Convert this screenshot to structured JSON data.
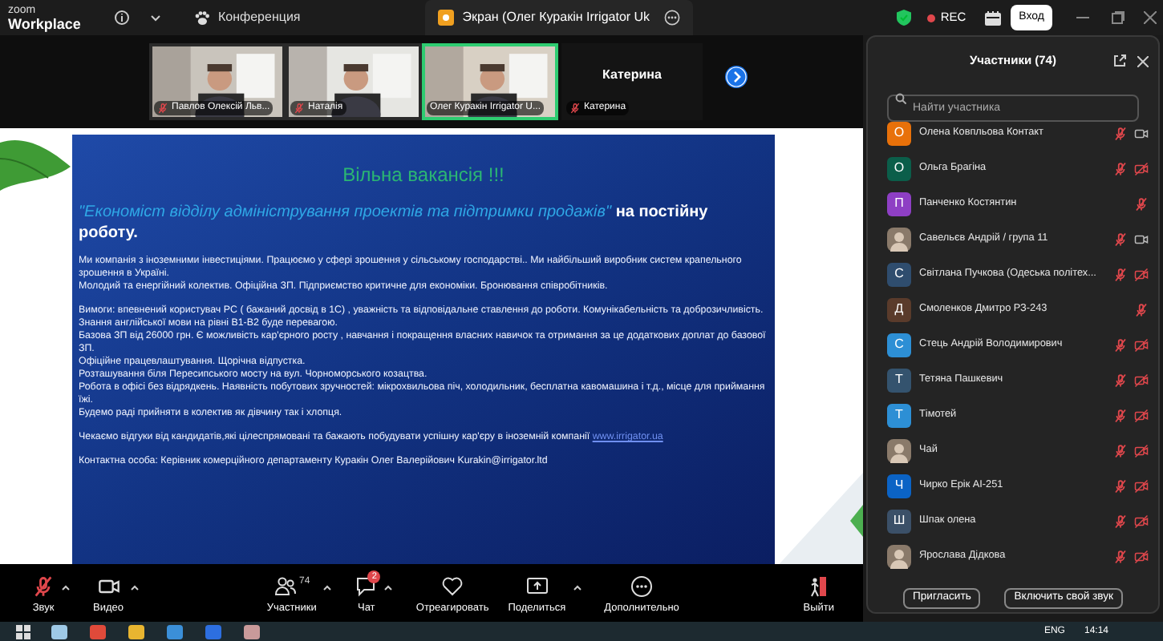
{
  "top_bar": {
    "logo_top": "zoom",
    "logo_bottom": "Workplace",
    "tabs": [
      {
        "label": "Конференция",
        "selected": false
      },
      {
        "label": "Экран (Олег Куракін Irrigator Uk",
        "selected": true
      }
    ],
    "recording": "REC",
    "signin": "Вход"
  },
  "gallery": {
    "tiles": [
      {
        "kind": "video",
        "name": "Павлов Олексій Льв...",
        "muted": true,
        "speaking": false
      },
      {
        "kind": "video",
        "name": "Наталія",
        "muted": true,
        "speaking": false
      },
      {
        "kind": "video",
        "name": "Олег Куракін Irrigator U...",
        "muted": false,
        "speaking": true
      },
      {
        "kind": "name_only",
        "name": "Катерина",
        "label": "Катерина",
        "muted": true,
        "speaking": false
      }
    ]
  },
  "slide": {
    "title": "Вільна вакансія !!!",
    "position": "\"Економіст відділу адміністрування проектів та підтримки продажів\"",
    "position_suffix": "на постійну роботу.",
    "groups": [
      [
        {
          "text": "Ми компанія з іноземними інвестиціями. Працюємо у сфері зрошення у сільському господарстві.. Ми найбільший виробник систем крапельного зрошення в Україні."
        },
        {
          "text": "Молодий та енергійний колектив. Офіційна ЗП. Підприємство критичне для економіки. Бронювання співробітників."
        }
      ],
      [
        {
          "text": "Вимоги: впевнений користувач PC ( бажаний досвід в 1С) , уважність та відповідальне ставлення до роботи. Комунікабельність та доброзичливість.  Знання англійської мови на рівні B1-B2 буде перевагою."
        },
        {
          "text": "Базова ЗП від 26000 грн. Є можливість кар'єрного росту , навчання і  покращення власних навичок та отримання за це додаткових доплат до базової ЗП."
        },
        {
          "text": "Офіційне працевлаштування. Щорічна відпустка."
        },
        {
          "text": "Розташування біля Пересипського мосту на вул. Чорноморського козацтва."
        },
        {
          "text": "Робота в офісі без відрядкень. Наявність побутових зручностей: мікрохвильова піч, холодильник, бесплатна кавомашина і т.д., місце для приймання їжі."
        },
        {
          "text": "Будемо раді прийняти в колектив як дівчину так і хлопця."
        }
      ],
      [
        {
          "text": "Чекаємо відгуки від кандидатів,які цілеспрямовані та бажають побудувати успішну кар'єру в іноземній компанії",
          "link": "www.irrigator.ua"
        }
      ],
      [
        {
          "text": "Контактна особа: Керівник комерційного департаменту Куракін Олег Валерійович  Kurakin@irrigator.ltd"
        }
      ]
    ]
  },
  "participants": {
    "title": "Участники (74)",
    "search": {
      "placeholder": "Найти участника"
    },
    "items": [
      {
        "name": "Олена Ковпльова Контакт",
        "avatar": {
          "kind": "letter",
          "letter": "О",
          "color": "#e8710a"
        },
        "muted": true,
        "video": true
      },
      {
        "name": "Ольга Брагіна",
        "avatar": {
          "kind": "letter",
          "letter": "О",
          "color": "#0b5e4a"
        },
        "muted": true,
        "video": false
      },
      {
        "name": "Панченко Костянтин",
        "avatar": {
          "kind": "letter",
          "letter": "П",
          "color": "#8e3fc4"
        },
        "muted": true
      },
      {
        "name": "Савельєв Андрій / група 11",
        "muted": true,
        "video": true
      },
      {
        "name": "Світлана Пучкова (Одеська політех...",
        "avatar": {
          "kind": "letter",
          "letter": "С",
          "color": "#2f4d6e"
        },
        "muted": true,
        "video": false
      },
      {
        "name": "Смоленков Дмитро РЗ-243",
        "avatar": {
          "kind": "letter",
          "letter": "Д",
          "color": "#5a3b2b"
        },
        "muted": true
      },
      {
        "name": "Стець Андрій Володимирович",
        "avatar": {
          "kind": "letter",
          "letter": "С",
          "color": "#2d8fd5"
        },
        "muted": true,
        "video": false
      },
      {
        "name": "Тетяна Пашкевич",
        "avatar": {
          "kind": "letter",
          "letter": "Т",
          "color": "#34536e"
        },
        "muted": true,
        "video": false
      },
      {
        "name": "Тімотей",
        "avatar": {
          "kind": "letter",
          "letter": "Т",
          "color": "#2d8fd5"
        },
        "muted": true,
        "video": false
      },
      {
        "name": "Чай",
        "muted": true,
        "video": false
      },
      {
        "name": "Чирко Ерік АІ-251",
        "avatar": {
          "kind": "letter",
          "letter": "Ч",
          "color": "#0b63c5"
        },
        "muted": true,
        "video": false
      },
      {
        "name": "Шпак олена",
        "avatar": {
          "kind": "letter",
          "letter": "Ш",
          "color": "#3b5068"
        },
        "muted": true,
        "video": false
      },
      {
        "name": "Ярослава Дідкова",
        "muted": true,
        "video": false
      }
    ],
    "buttons": [
      "Пригласить",
      "Включить свой звук"
    ]
  },
  "toolbar": {
    "left": [
      {
        "kind": "audio",
        "label": "Звук",
        "muted": true,
        "caret": true
      },
      {
        "kind": "video",
        "label": "Видео",
        "caret": true
      }
    ],
    "center": [
      {
        "kind": "participants",
        "label": "Участники",
        "count": "74",
        "caret": true
      },
      {
        "kind": "chat",
        "label": "Чат",
        "badge": "2",
        "caret": true
      },
      {
        "kind": "react",
        "label": "Отреагировать"
      },
      {
        "kind": "share",
        "label": "Поделиться",
        "caret": true
      },
      {
        "kind": "more",
        "label": "Дополнительно"
      }
    ],
    "right": [
      {
        "kind": "leave",
        "label": "Выйти"
      }
    ]
  },
  "taskbar": {
    "language": "ENG",
    "time": "14:14"
  }
}
